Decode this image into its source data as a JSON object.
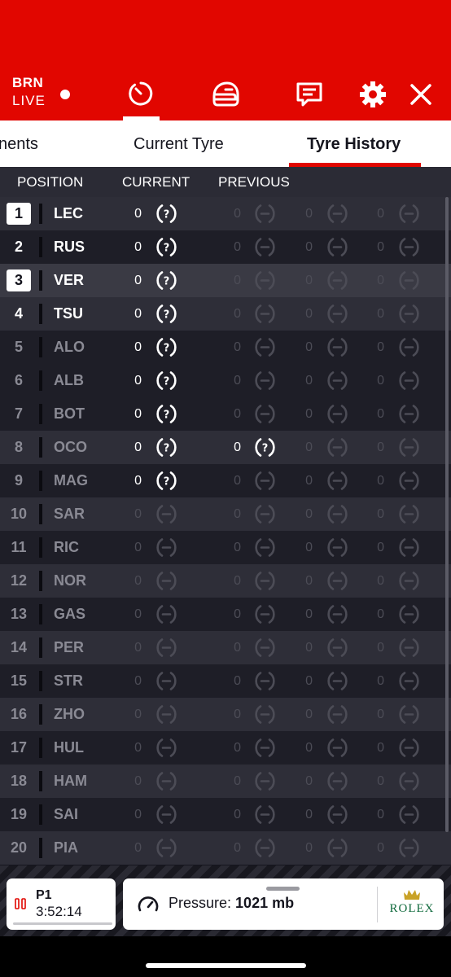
{
  "header": {
    "session_code": "BRN",
    "session_status": "LIVE",
    "icons": [
      "timer-icon",
      "helmet-icon",
      "radio-messages-icon",
      "gear-icon",
      "close-icon"
    ],
    "accent_color": "#e10600"
  },
  "tabs": [
    {
      "label": "nents"
    },
    {
      "label": "Current Tyre"
    },
    {
      "label": "Tyre History",
      "active": true
    }
  ],
  "columns": {
    "position": "POSITION",
    "current": "CURRENT",
    "previous": "PREVIOUS"
  },
  "rows": [
    {
      "pos": "1",
      "driver": "LEC",
      "current": {
        "laps": "0",
        "tyre": "unknown"
      },
      "previous": [
        {
          "laps": "0",
          "tyre": "none"
        },
        {
          "laps": "0",
          "tyre": "none"
        },
        {
          "laps": "0",
          "tyre": "none"
        }
      ]
    },
    {
      "pos": "2",
      "driver": "RUS",
      "current": {
        "laps": "0",
        "tyre": "unknown"
      },
      "previous": [
        {
          "laps": "0",
          "tyre": "none"
        },
        {
          "laps": "0",
          "tyre": "none"
        },
        {
          "laps": "0",
          "tyre": "none"
        }
      ]
    },
    {
      "pos": "3",
      "driver": "VER",
      "current": {
        "laps": "0",
        "tyre": "unknown"
      },
      "previous": [
        {
          "laps": "0",
          "tyre": "none"
        },
        {
          "laps": "0",
          "tyre": "none"
        },
        {
          "laps": "0",
          "tyre": "none"
        }
      ]
    },
    {
      "pos": "4",
      "driver": "TSU",
      "current": {
        "laps": "0",
        "tyre": "unknown"
      },
      "previous": [
        {
          "laps": "0",
          "tyre": "none"
        },
        {
          "laps": "0",
          "tyre": "none"
        },
        {
          "laps": "0",
          "tyre": "none"
        }
      ]
    },
    {
      "pos": "5",
      "driver": "ALO",
      "current": {
        "laps": "0",
        "tyre": "unknown"
      },
      "previous": [
        {
          "laps": "0",
          "tyre": "none"
        },
        {
          "laps": "0",
          "tyre": "none"
        },
        {
          "laps": "0",
          "tyre": "none"
        }
      ]
    },
    {
      "pos": "6",
      "driver": "ALB",
      "current": {
        "laps": "0",
        "tyre": "unknown"
      },
      "previous": [
        {
          "laps": "0",
          "tyre": "none"
        },
        {
          "laps": "0",
          "tyre": "none"
        },
        {
          "laps": "0",
          "tyre": "none"
        }
      ]
    },
    {
      "pos": "7",
      "driver": "BOT",
      "current": {
        "laps": "0",
        "tyre": "unknown"
      },
      "previous": [
        {
          "laps": "0",
          "tyre": "none"
        },
        {
          "laps": "0",
          "tyre": "none"
        },
        {
          "laps": "0",
          "tyre": "none"
        }
      ]
    },
    {
      "pos": "8",
      "driver": "OCO",
      "current": {
        "laps": "0",
        "tyre": "unknown"
      },
      "previous": [
        {
          "laps": "0",
          "tyre": "unknown"
        },
        {
          "laps": "0",
          "tyre": "none"
        },
        {
          "laps": "0",
          "tyre": "none"
        }
      ]
    },
    {
      "pos": "9",
      "driver": "MAG",
      "current": {
        "laps": "0",
        "tyre": "unknown"
      },
      "previous": [
        {
          "laps": "0",
          "tyre": "none"
        },
        {
          "laps": "0",
          "tyre": "none"
        },
        {
          "laps": "0",
          "tyre": "none"
        }
      ]
    },
    {
      "pos": "10",
      "driver": "SAR",
      "current": {
        "laps": "0",
        "tyre": "none"
      },
      "previous": [
        {
          "laps": "0",
          "tyre": "none"
        },
        {
          "laps": "0",
          "tyre": "none"
        },
        {
          "laps": "0",
          "tyre": "none"
        }
      ]
    },
    {
      "pos": "11",
      "driver": "RIC",
      "current": {
        "laps": "0",
        "tyre": "none"
      },
      "previous": [
        {
          "laps": "0",
          "tyre": "none"
        },
        {
          "laps": "0",
          "tyre": "none"
        },
        {
          "laps": "0",
          "tyre": "none"
        }
      ]
    },
    {
      "pos": "12",
      "driver": "NOR",
      "current": {
        "laps": "0",
        "tyre": "none"
      },
      "previous": [
        {
          "laps": "0",
          "tyre": "none"
        },
        {
          "laps": "0",
          "tyre": "none"
        },
        {
          "laps": "0",
          "tyre": "none"
        }
      ]
    },
    {
      "pos": "13",
      "driver": "GAS",
      "current": {
        "laps": "0",
        "tyre": "none"
      },
      "previous": [
        {
          "laps": "0",
          "tyre": "none"
        },
        {
          "laps": "0",
          "tyre": "none"
        },
        {
          "laps": "0",
          "tyre": "none"
        }
      ]
    },
    {
      "pos": "14",
      "driver": "PER",
      "current": {
        "laps": "0",
        "tyre": "none"
      },
      "previous": [
        {
          "laps": "0",
          "tyre": "none"
        },
        {
          "laps": "0",
          "tyre": "none"
        },
        {
          "laps": "0",
          "tyre": "none"
        }
      ]
    },
    {
      "pos": "15",
      "driver": "STR",
      "current": {
        "laps": "0",
        "tyre": "none"
      },
      "previous": [
        {
          "laps": "0",
          "tyre": "none"
        },
        {
          "laps": "0",
          "tyre": "none"
        },
        {
          "laps": "0",
          "tyre": "none"
        }
      ]
    },
    {
      "pos": "16",
      "driver": "ZHO",
      "current": {
        "laps": "0",
        "tyre": "none"
      },
      "previous": [
        {
          "laps": "0",
          "tyre": "none"
        },
        {
          "laps": "0",
          "tyre": "none"
        },
        {
          "laps": "0",
          "tyre": "none"
        }
      ]
    },
    {
      "pos": "17",
      "driver": "HUL",
      "current": {
        "laps": "0",
        "tyre": "none"
      },
      "previous": [
        {
          "laps": "0",
          "tyre": "none"
        },
        {
          "laps": "0",
          "tyre": "none"
        },
        {
          "laps": "0",
          "tyre": "none"
        }
      ]
    },
    {
      "pos": "18",
      "driver": "HAM",
      "current": {
        "laps": "0",
        "tyre": "none"
      },
      "previous": [
        {
          "laps": "0",
          "tyre": "none"
        },
        {
          "laps": "0",
          "tyre": "none"
        },
        {
          "laps": "0",
          "tyre": "none"
        }
      ]
    },
    {
      "pos": "19",
      "driver": "SAI",
      "current": {
        "laps": "0",
        "tyre": "none"
      },
      "previous": [
        {
          "laps": "0",
          "tyre": "none"
        },
        {
          "laps": "0",
          "tyre": "none"
        },
        {
          "laps": "0",
          "tyre": "none"
        }
      ]
    },
    {
      "pos": "20",
      "driver": "PIA",
      "current": {
        "laps": "0",
        "tyre": "none"
      },
      "previous": [
        {
          "laps": "0",
          "tyre": "none"
        },
        {
          "laps": "0",
          "tyre": "none"
        },
        {
          "laps": "0",
          "tyre": "none"
        }
      ]
    }
  ],
  "session_card": {
    "label": "P1",
    "clock": "3:52:14",
    "icon": "pause-icon"
  },
  "weather_card": {
    "label": "Pressure:",
    "value": "1021 mb",
    "icon": "gauge-icon",
    "sponsor": "ROLEX",
    "sponsor_color": "#126b3e"
  }
}
